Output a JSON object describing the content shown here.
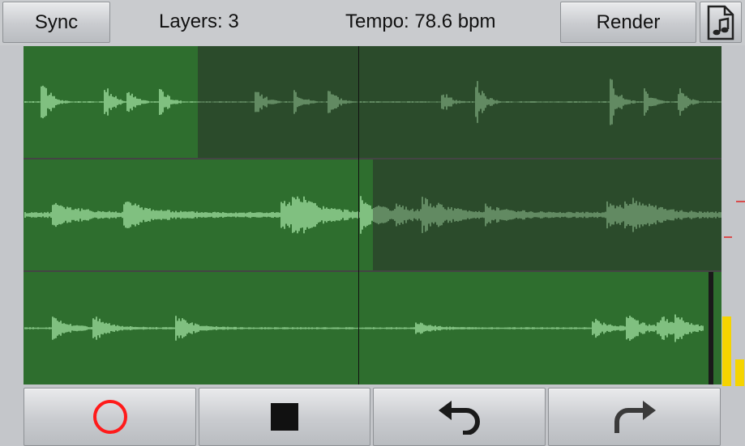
{
  "toolbar": {
    "sync_label": "Sync",
    "layers_text": "Layers: 3",
    "tempo_text": "Tempo: 78.6 bpm",
    "render_label": "Render",
    "file_icon": "music-file-icon"
  },
  "tracks": [
    {
      "name": "layer-1",
      "progress": 0.25
    },
    {
      "name": "layer-2",
      "progress": 0.5
    },
    {
      "name": "layer-3",
      "progress": 1.0
    }
  ],
  "playhead_position": 0.48,
  "level_meter": {
    "left": 0.78,
    "right": 0.3
  },
  "transport": {
    "record_icon": "record-icon",
    "stop_icon": "stop-icon",
    "undo_icon": "undo-icon",
    "redo_icon": "redo-icon"
  },
  "colors": {
    "track_played": "#2e6e2e",
    "track_unplayed": "#2b4b2b",
    "wave_bright": "#a4e3a4",
    "wave_dim": "#7aa67a",
    "record": "#ff1a1a",
    "meter": "#f5d400"
  }
}
